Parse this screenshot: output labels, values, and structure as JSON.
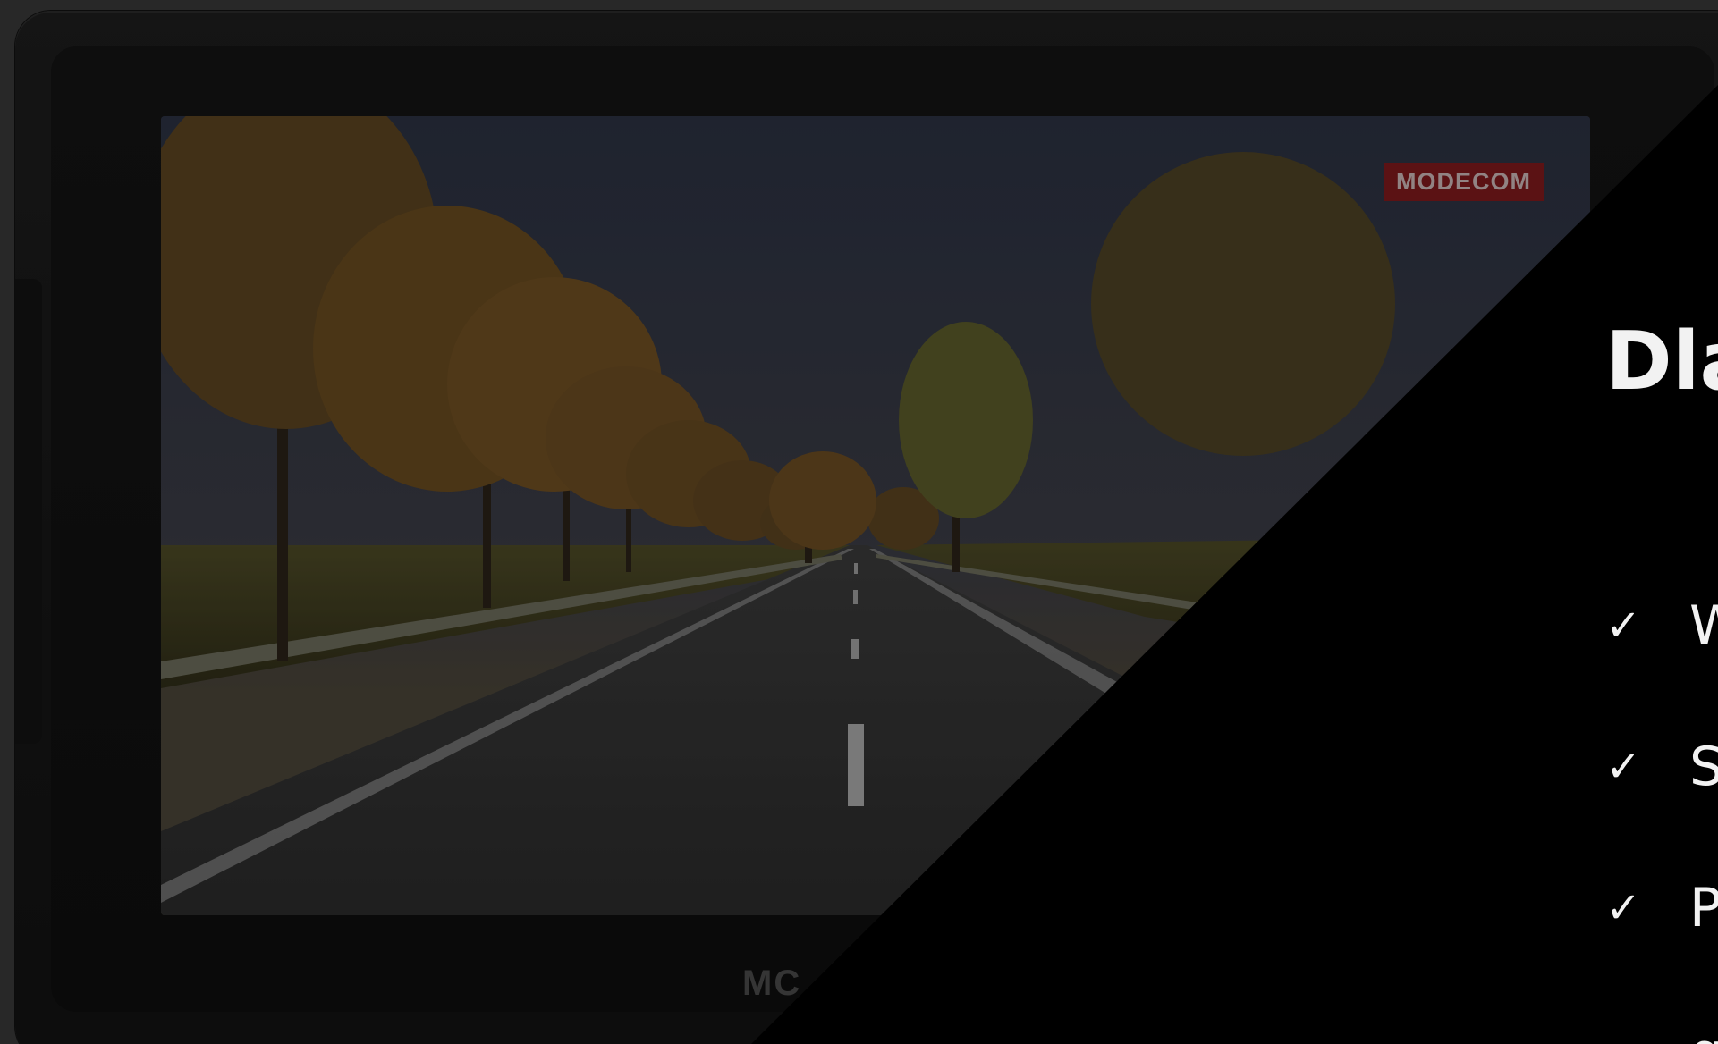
{
  "device": {
    "screen_badge": "MODECOM",
    "bezel_logo": "MC"
  },
  "panel": {
    "title": "Dla",
    "features": [
      {
        "icon": "check-icon",
        "check": "✓",
        "text": "W"
      },
      {
        "icon": "check-icon",
        "check": "✓",
        "text": "S"
      },
      {
        "icon": "check-icon",
        "check": "✓",
        "text": "P"
      }
    ],
    "continuation": "g"
  },
  "colors": {
    "badge": "#7e1a1d",
    "panel": "#000000",
    "panel_text": "#f2f2f2"
  }
}
